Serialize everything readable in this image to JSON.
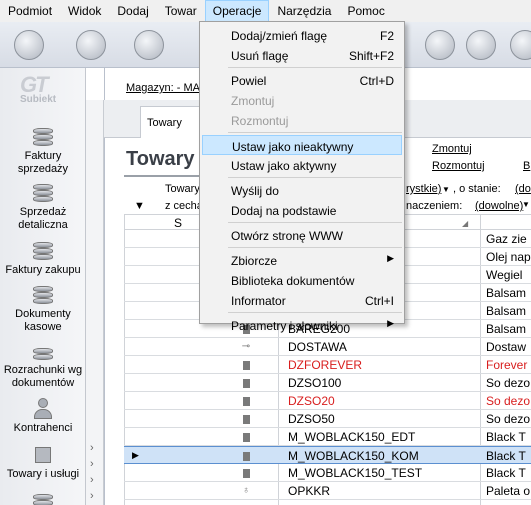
{
  "menubar": [
    "Podmiot",
    "Widok",
    "Dodaj",
    "Towar",
    "Operacje",
    "Narzędzia",
    "Pomoc"
  ],
  "nav": {
    "logo_text": "GT",
    "logo_sub": "Subiekt",
    "items": [
      {
        "l1": "Faktury",
        "l2": "sprzedaży"
      },
      {
        "l1": "Sprzedaż",
        "l2": "detaliczna"
      },
      {
        "l1": "Faktury zakupu",
        "l2": ""
      },
      {
        "l1": "Dokumenty",
        "l2": "kasowe"
      },
      {
        "l1": "Rozrachunki wg",
        "l2": "dokumentów"
      },
      {
        "l1": "Kontrahenci",
        "l2": ""
      },
      {
        "l1": "Towary i usługi",
        "l2": ""
      }
    ]
  },
  "main": {
    "magazyn": "Magazyn: - MA",
    "tab": "Towary",
    "title": "Towary",
    "link_zmontuj": "Zmontuj",
    "link_rozmontuj": "Rozmontuj",
    "link_b": "B",
    "filter1_a": "Towary",
    "filter1_b": "rystkie)",
    "filter1_c": ", o stanie:",
    "filter1_d": "(do",
    "filter2_a": "z cecha",
    "filter2_b": "naczeniem:",
    "filter2_c": "(dowolne)",
    "col_s": "S"
  },
  "rows": [
    {
      "icon": "",
      "code": "",
      "name": "Gaz zie",
      "red": false,
      "sel": false
    },
    {
      "icon": "",
      "code": "",
      "name": "Olej nap",
      "red": false,
      "sel": false
    },
    {
      "icon": "",
      "code": "",
      "name": "Wegiel",
      "red": false,
      "sel": false
    },
    {
      "icon": "",
      "code": "",
      "name": "Balsam",
      "red": false,
      "sel": false
    },
    {
      "icon": "",
      "code": "",
      "name": "Balsam",
      "red": false,
      "sel": false
    },
    {
      "icon": "sq",
      "code": "BAREG200",
      "name": "Balsam",
      "red": false,
      "sel": false
    },
    {
      "icon": "wrench",
      "code": "DOSTAWA",
      "name": "Dostaw",
      "red": false,
      "sel": false
    },
    {
      "icon": "sq",
      "code": "DZFOREVER",
      "name": "Forever",
      "red": true,
      "sel": false
    },
    {
      "icon": "sq",
      "code": "DZSO100",
      "name": "So dezo",
      "red": false,
      "sel": false
    },
    {
      "icon": "sq",
      "code": "DZSO20",
      "name": "So dezo",
      "red": true,
      "sel": false
    },
    {
      "icon": "sq",
      "code": "DZSO50",
      "name": "So dezo",
      "red": false,
      "sel": false
    },
    {
      "icon": "sq",
      "code": "M_WOBLACK150_EDT",
      "name": "Black T",
      "red": false,
      "sel": false
    },
    {
      "icon": "sq",
      "code": "M_WOBLACK150_KOM",
      "name": "Black T",
      "red": false,
      "sel": true
    },
    {
      "icon": "sq",
      "code": "M_WOBLACK150_TEST",
      "name": "Black T",
      "red": false,
      "sel": false
    },
    {
      "icon": "bag",
      "code": "OPKKR",
      "name": "Paleta o",
      "red": false,
      "sel": false
    }
  ],
  "dropdown": [
    {
      "label": "Dodaj/zmień flagę",
      "shortcut": "F2",
      "disabled": false,
      "hl": false,
      "sub": false
    },
    {
      "label": "Usuń flagę",
      "shortcut": "Shift+F2",
      "disabled": false,
      "hl": false,
      "sub": false
    },
    {
      "sep": true
    },
    {
      "label": "Powiel",
      "shortcut": "Ctrl+D",
      "disabled": false,
      "hl": false,
      "sub": false
    },
    {
      "label": "Zmontuj",
      "shortcut": "",
      "disabled": true,
      "hl": false,
      "sub": false
    },
    {
      "label": "Rozmontuj",
      "shortcut": "",
      "disabled": true,
      "hl": false,
      "sub": false
    },
    {
      "sep": true
    },
    {
      "label": "Ustaw jako nieaktywny",
      "shortcut": "",
      "disabled": false,
      "hl": true,
      "sub": false
    },
    {
      "label": "Ustaw jako aktywny",
      "shortcut": "",
      "disabled": false,
      "hl": false,
      "sub": false
    },
    {
      "sep": true
    },
    {
      "label": "Wyślij do",
      "shortcut": "",
      "disabled": false,
      "hl": false,
      "sub": false
    },
    {
      "label": "Dodaj na podstawie",
      "shortcut": "",
      "disabled": false,
      "hl": false,
      "sub": false
    },
    {
      "sep": true
    },
    {
      "label": "Otwórz stronę WWW",
      "shortcut": "",
      "disabled": false,
      "hl": false,
      "sub": false
    },
    {
      "sep": true
    },
    {
      "label": "Zbiorcze",
      "shortcut": "",
      "disabled": false,
      "hl": false,
      "sub": true
    },
    {
      "label": "Biblioteka dokumentów",
      "shortcut": "",
      "disabled": false,
      "hl": false,
      "sub": false
    },
    {
      "label": "Informator",
      "shortcut": "Ctrl+I",
      "disabled": false,
      "hl": false,
      "sub": false
    },
    {
      "sep": true
    },
    {
      "label": "Parametry i słowniki",
      "shortcut": "",
      "disabled": false,
      "hl": false,
      "sub": true
    }
  ]
}
